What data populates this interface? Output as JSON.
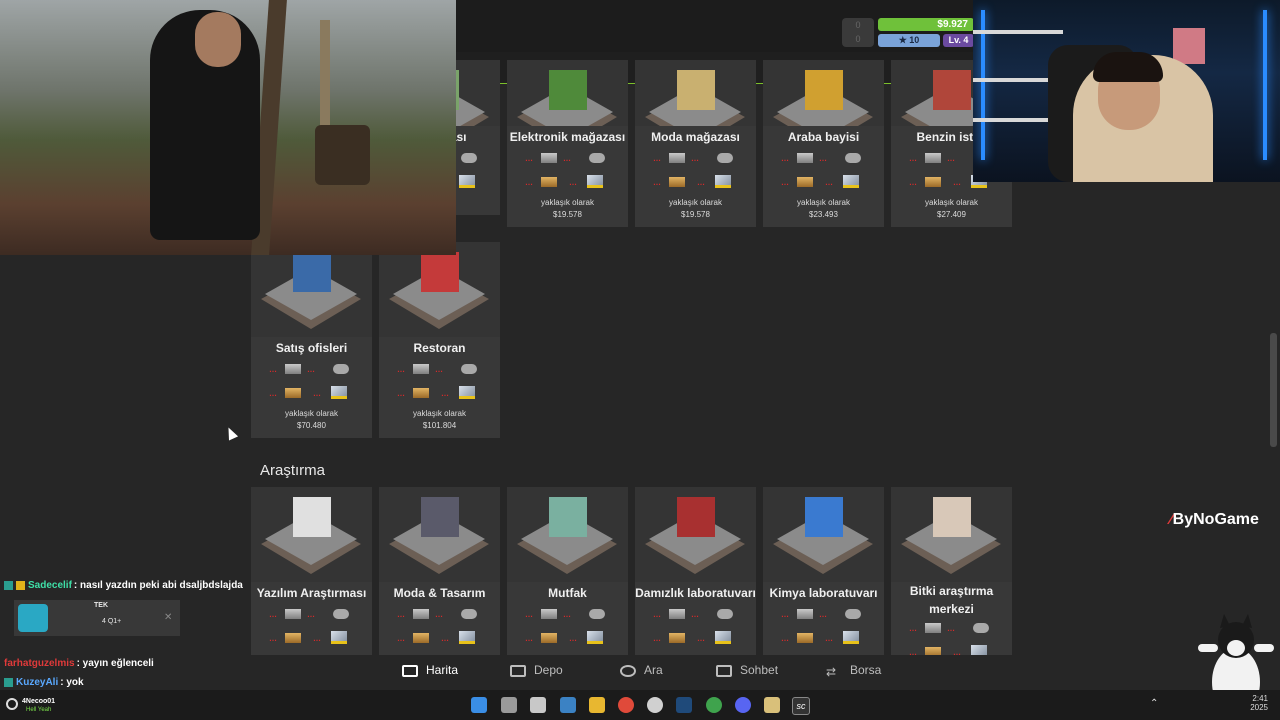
{
  "hud": {
    "money": "$9.927",
    "stars": "★ 10",
    "level": "Lv. 4",
    "xp_top": "0",
    "xp_bottom": "0"
  },
  "sections": {
    "research_title": "Araştırma"
  },
  "store_cards": [
    {
      "name": "mağazası",
      "r1": "",
      "r2": "",
      "r3": "",
      "r4": "",
      "approx": "olarak",
      "price": ""
    },
    {
      "name": "Elektronik mağazası",
      "r1": "…",
      "r2": "…",
      "r3": "…",
      "r4": "…",
      "approx": "yaklaşık olarak",
      "price": "$19.578"
    },
    {
      "name": "Moda mağazası",
      "r1": "…",
      "r2": "…",
      "r3": "…",
      "r4": "…",
      "approx": "yaklaşık olarak",
      "price": "$19.578"
    },
    {
      "name": "Araba bayisi",
      "r1": "…",
      "r2": "…",
      "r3": "…",
      "r4": "…",
      "approx": "yaklaşık olarak",
      "price": "$23.493"
    },
    {
      "name": "Benzin istas",
      "r1": "…",
      "r2": "…",
      "r3": "…",
      "r4": "…",
      "approx": "yaklaşık olarak",
      "price": "$27.409"
    }
  ],
  "second_row": [
    {
      "name": "Satış ofisleri",
      "r1": "…",
      "r2": "…",
      "r3": "…",
      "r4": "…",
      "approx": "yaklaşık olarak",
      "price": "$70.480"
    },
    {
      "name": "Restoran",
      "r1": "…",
      "r2": "…",
      "r3": "…",
      "r4": "…",
      "approx": "yaklaşık olarak",
      "price": "$101.804"
    }
  ],
  "research_cards": [
    {
      "name": "Yazılım Araştırması",
      "r1": "…",
      "r2": "…",
      "r3": "…",
      "r4": "…"
    },
    {
      "name": "Moda & Tasarım",
      "r1": "…",
      "r2": "…",
      "r3": "…",
      "r4": "…"
    },
    {
      "name": "Mutfak",
      "r1": "…",
      "r2": "…",
      "r3": "…",
      "r4": "…"
    },
    {
      "name": "Damızlık laboratuvarı",
      "r1": "…",
      "r2": "…",
      "r3": "…",
      "r4": "…"
    },
    {
      "name": "Kimya laboratuvarı",
      "r1": "…",
      "r2": "…",
      "r3": "…",
      "r4": "…"
    },
    {
      "name": "Bitki araştırma merkezi",
      "r1": "…",
      "r2": "…",
      "r3": "…",
      "r4": "…"
    }
  ],
  "watermark": "ByNoGame",
  "chat": [
    {
      "user": "Sadecelif",
      "msg": ": nasıl yazdın peki abi dsaljbdslajda",
      "color": "#3fe0a8"
    },
    {
      "user": "farhatguzelmis",
      "msg": ": yayın eğlenceli",
      "color": "#e03a3a"
    },
    {
      "user": "KuzeyAli",
      "msg": ": yok",
      "color": "#5aa9ff"
    }
  ],
  "chat_overlay": {
    "title": "TEK",
    "sub": "4 Q1+"
  },
  "nav": {
    "map": "Harita",
    "depot": "Depo",
    "search": "Ara",
    "chat": "Sohbet",
    "exchange": "Borsa"
  },
  "taskbar": {
    "user": "4Necoo01",
    "user_sub": "Hell Yeah",
    "time": "2:41",
    "year": "2025"
  }
}
